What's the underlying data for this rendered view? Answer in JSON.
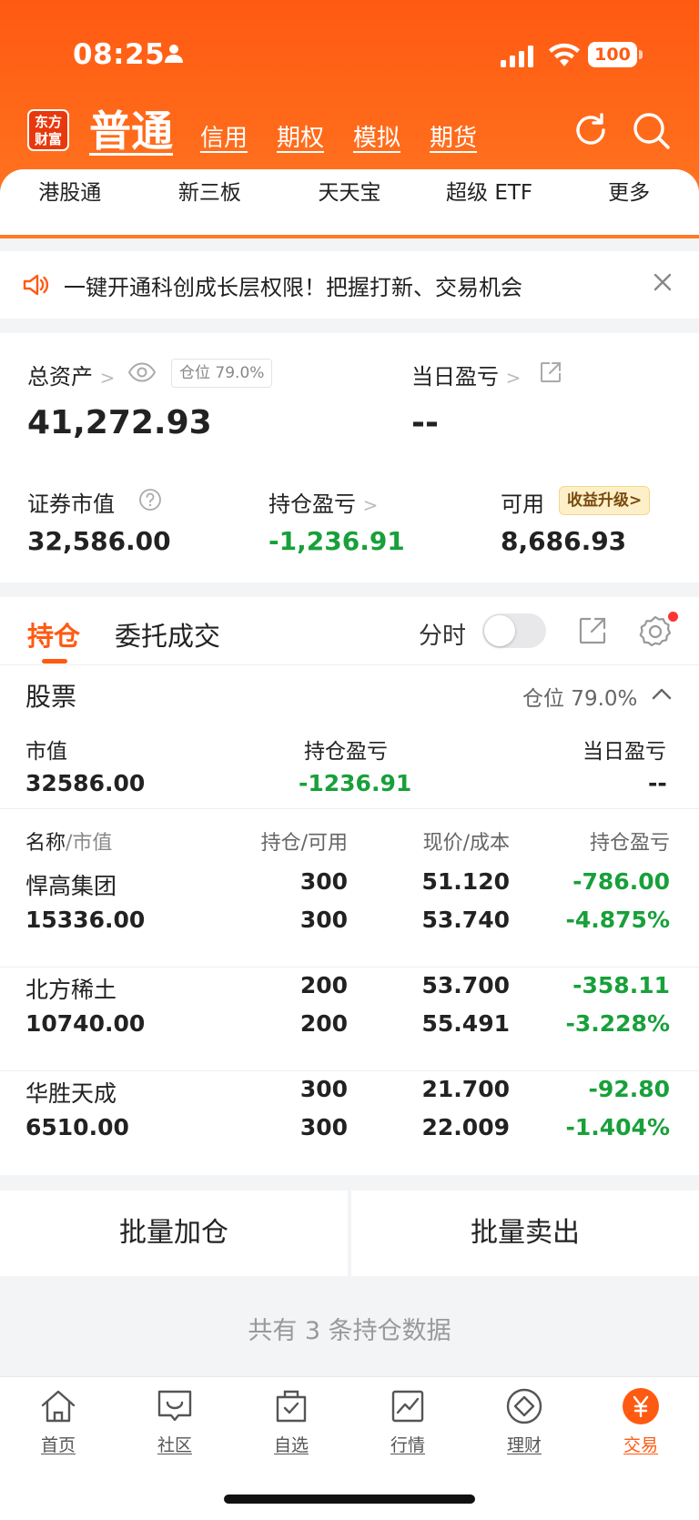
{
  "status_bar": {
    "time": "08:25",
    "battery": "100"
  },
  "header": {
    "logo": [
      "东方",
      "财富"
    ],
    "account_tabs": [
      {
        "label": "普通",
        "active": true
      },
      {
        "label": "信用",
        "active": false
      },
      {
        "label": "期权",
        "active": false
      },
      {
        "label": "模拟",
        "active": false
      },
      {
        "label": "期货",
        "active": false
      }
    ],
    "icons": [
      "refresh-icon",
      "search-icon"
    ]
  },
  "subnav": [
    "港股通",
    "新三板",
    "天天宝",
    "超级 ETF",
    "更多"
  ],
  "banner": {
    "text": "一键开通科创成长层权限！把握打新、交易机会"
  },
  "assets": {
    "total_label": "总资产",
    "total_value": "41,272.93",
    "position_chip": "仓位 79.0%",
    "daily_pl_label": "当日盈亏",
    "daily_pl_value": "--",
    "market_value_label": "证券市值",
    "market_value": "32,586.00",
    "holding_pl_label": "持仓盈亏",
    "holding_pl_value": "-1,236.91",
    "available_label": "可用",
    "available_value": "8,686.93",
    "upgrade_label": "收益升级"
  },
  "holdings": {
    "tab_positions": "持仓",
    "tab_orders": "委托成交",
    "fenshi_label": "分时",
    "fenshi_on": false,
    "section_title": "股票",
    "section_ratio": "仓位 79.0%",
    "summary": {
      "mv_label": "市值",
      "mv_value": "32586.00",
      "pl_label": "持仓盈亏",
      "pl_value": "-1236.91",
      "day_label": "当日盈亏",
      "day_value": "--"
    },
    "columns": {
      "name": "名称",
      "mv": "/市值",
      "qty": "持仓/可用",
      "price": "现价/成本",
      "pl": "持仓盈亏"
    },
    "rows": [
      {
        "name": "悍高集团",
        "mv": "15336.00",
        "qty": "300",
        "avail": "300",
        "price": "51.120",
        "cost": "53.740",
        "pl": "-786.00",
        "pl_pct": "-4.875%"
      },
      {
        "name": "北方稀土",
        "mv": "10740.00",
        "qty": "200",
        "avail": "200",
        "price": "53.700",
        "cost": "55.491",
        "pl": "-358.11",
        "pl_pct": "-3.228%"
      },
      {
        "name": "华胜天成",
        "mv": "6510.00",
        "qty": "300",
        "avail": "300",
        "price": "21.700",
        "cost": "22.009",
        "pl": "-92.80",
        "pl_pct": "-1.404%"
      }
    ]
  },
  "batch": {
    "add": "批量加仓",
    "sell": "批量卖出"
  },
  "footer_note": "共有 3 条持仓数据",
  "bottom_nav": [
    {
      "label": "首页",
      "icon": "home-icon",
      "active": false
    },
    {
      "label": "社区",
      "icon": "chat-icon",
      "active": false
    },
    {
      "label": "自选",
      "icon": "watchlist-icon",
      "active": false
    },
    {
      "label": "行情",
      "icon": "chart-icon",
      "active": false
    },
    {
      "label": "理财",
      "icon": "diamond-icon",
      "active": false
    },
    {
      "label": "交易",
      "icon": "yen-icon",
      "active": true
    }
  ],
  "colors": {
    "brand": "#ff5a12",
    "loss": "#18a03a"
  }
}
